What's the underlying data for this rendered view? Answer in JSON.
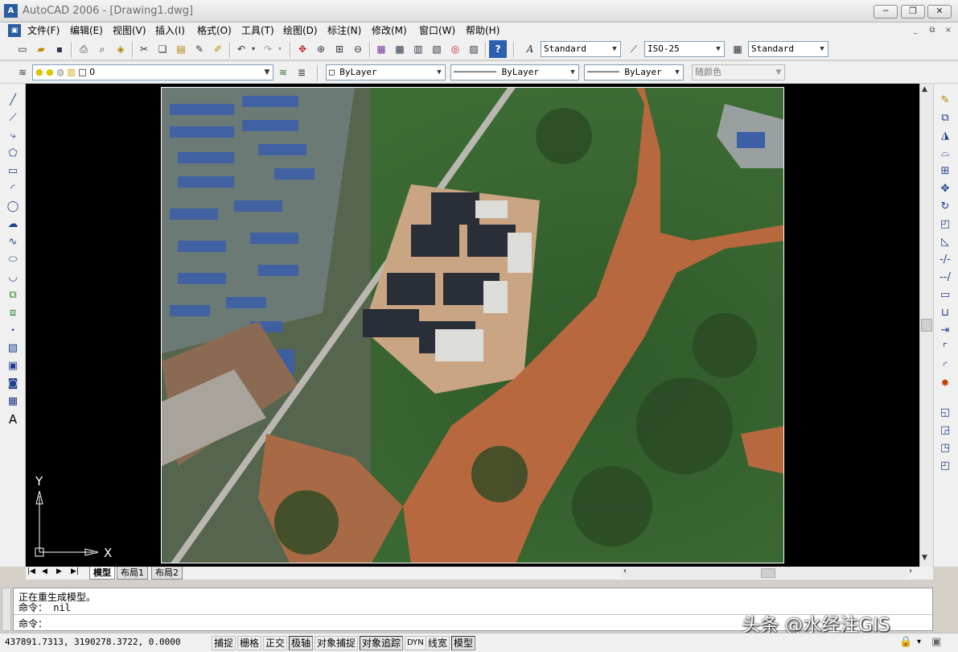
{
  "window": {
    "title": "AutoCAD 2006 - [Drawing1.dwg]",
    "minimize": "─",
    "restore": "❐",
    "close": "✕",
    "doc_minimize": "_",
    "doc_restore": "⧉",
    "doc_close": "×"
  },
  "menu": [
    "文件(F)",
    "编辑(E)",
    "视图(V)",
    "插入(I)",
    "格式(O)",
    "工具(T)",
    "绘图(D)",
    "标注(N)",
    "修改(M)",
    "窗口(W)",
    "帮助(H)"
  ],
  "standard_toolbar": {
    "text_style": "Standard",
    "dim_style": "ISO-25",
    "table_style": "Standard"
  },
  "layers_toolbar": {
    "layer": "0",
    "color": "ByLayer",
    "linetype": "ByLayer",
    "lineweight": "ByLayer",
    "plot_style": "随颜色"
  },
  "ucs": {
    "x_label": "X",
    "y_label": "Y"
  },
  "tabs": [
    "模型",
    "布局1",
    "布局2"
  ],
  "command_window": {
    "line1": "正在重生成模型。",
    "line2": "命令： nil",
    "prompt": "命令："
  },
  "statusbar": {
    "coords": "437891.7313, 3190278.3722, 0.0000",
    "buttons": [
      "捕捉",
      "栅格",
      "正交",
      "极轴",
      "对象捕捉",
      "对象追踪",
      "DYN",
      "线宽",
      "模型"
    ]
  },
  "watermark": "头条 @水经注GIS",
  "colors": {
    "canvas": "#000000",
    "toolbar_bg": "#f0f0f0",
    "icon_blue": "#1e3f8a"
  }
}
